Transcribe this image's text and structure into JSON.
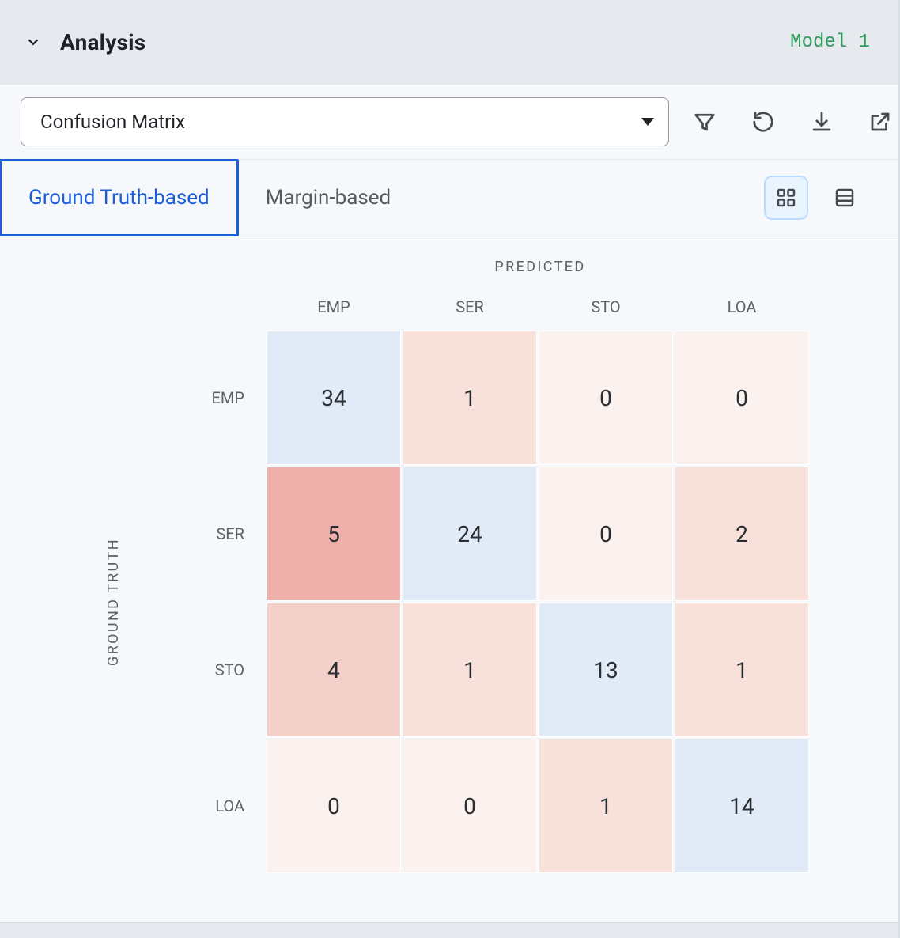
{
  "header": {
    "title": "Analysis",
    "model_label": "Model 1"
  },
  "toolbar": {
    "select_label": "Confusion Matrix",
    "icons": {
      "filter": "filter-icon",
      "refresh": "refresh-icon",
      "download": "download-icon",
      "open": "open-external-icon"
    }
  },
  "tabs": {
    "items": [
      {
        "label": "Ground Truth-based",
        "active": true
      },
      {
        "label": "Margin-based",
        "active": false
      }
    ]
  },
  "view_toggles": {
    "grid": "grid-view-icon",
    "list": "list-view-icon",
    "active": "grid"
  },
  "axes": {
    "predicted_title": "PREDICTED",
    "groundtruth_title": "GROUND TRUTH"
  },
  "chart_data": {
    "type": "heatmap",
    "title": "Confusion Matrix",
    "xlabel": "PREDICTED",
    "ylabel": "GROUND TRUTH",
    "categories_x": [
      "EMP",
      "SER",
      "STO",
      "LOA"
    ],
    "categories_y": [
      "EMP",
      "SER",
      "STO",
      "LOA"
    ],
    "values": [
      [
        34,
        1,
        0,
        0
      ],
      [
        5,
        24,
        0,
        2
      ],
      [
        4,
        1,
        13,
        1
      ],
      [
        0,
        0,
        1,
        14
      ]
    ],
    "colors": {
      "diagonal": "#e1ebf7",
      "off_diag_scale": [
        "#fbf2ef",
        "#f8e1db",
        "#f3d0ca",
        "#efafab"
      ]
    }
  }
}
